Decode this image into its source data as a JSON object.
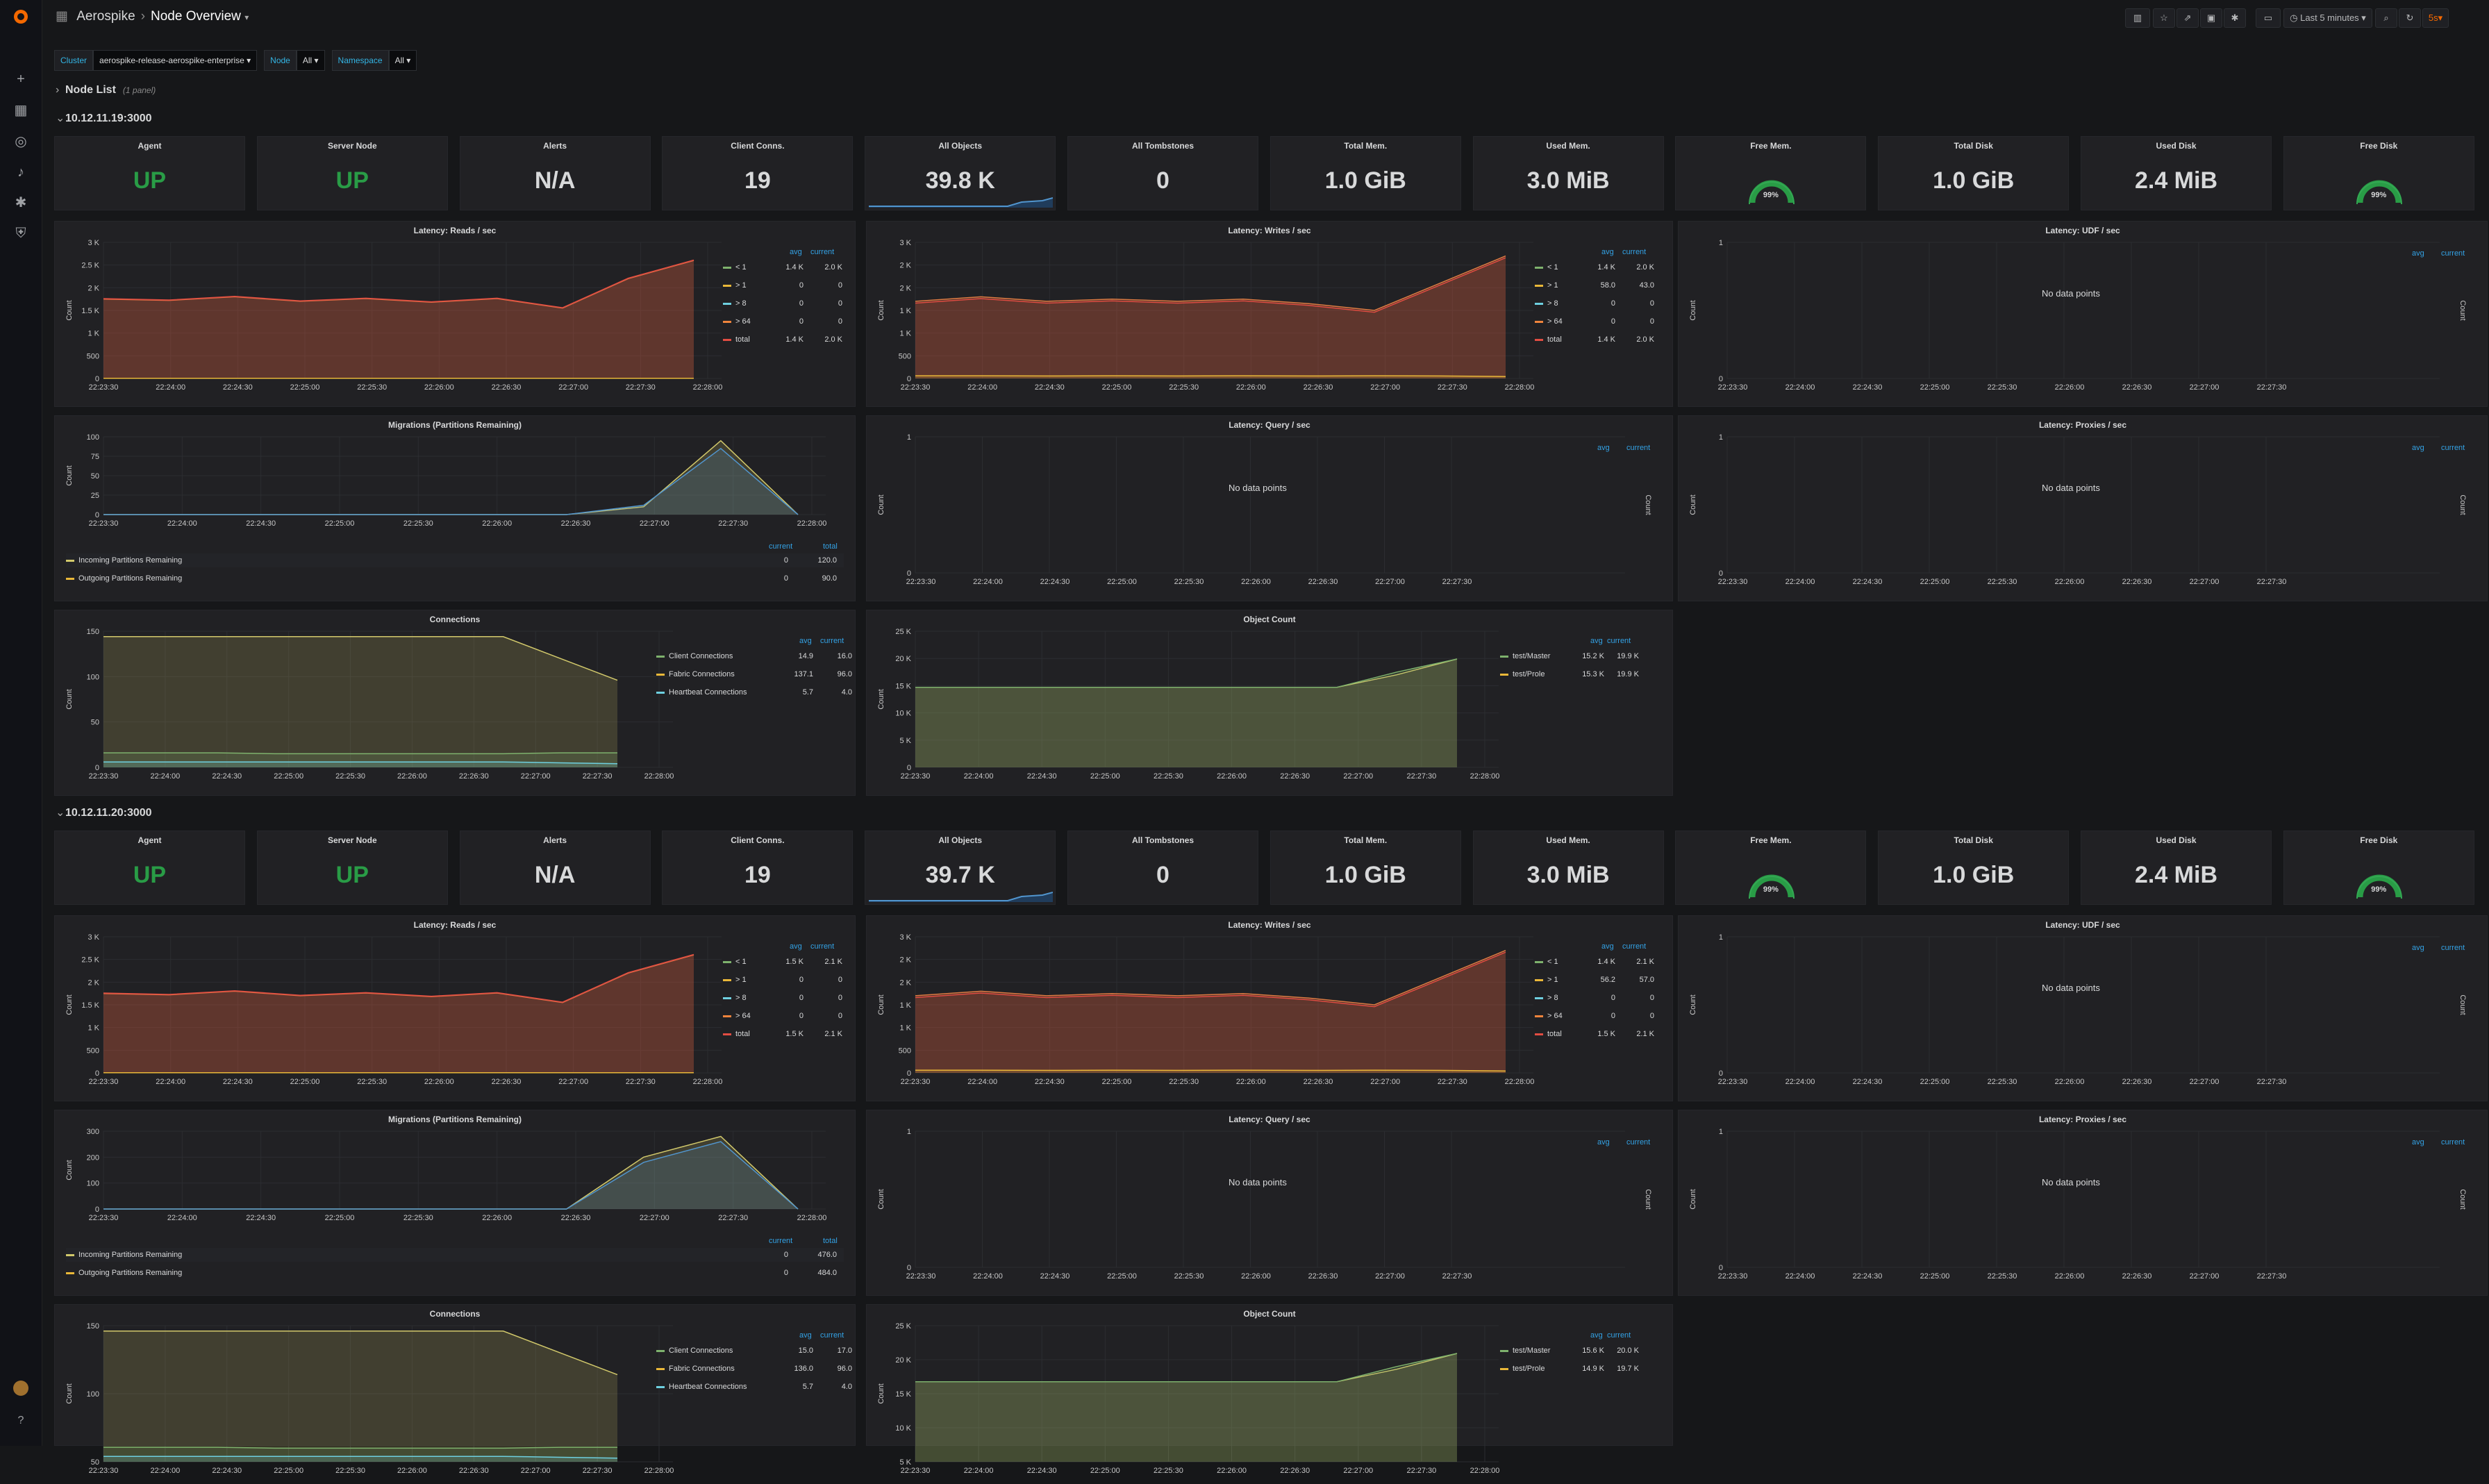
{
  "breadcrumb": {
    "folder": "Aerospike",
    "title": "Node Overview"
  },
  "toolbar": {
    "time_range": "Last 5 minutes",
    "refresh": "5s"
  },
  "variables": [
    {
      "label": "Cluster",
      "value": "aerospike-release-aerospike-enterprise"
    },
    {
      "label": "Node",
      "value": "All"
    },
    {
      "label": "Namespace",
      "value": "All"
    }
  ],
  "node_list": {
    "title": "Node List",
    "sub": "(1 panel)"
  },
  "colors": {
    "green": "#299c46",
    "yellow": "#d2c96b",
    "orange": "#e07b43",
    "blue": "#5195ce",
    "accent": "#33a2e5"
  },
  "common": {
    "times": [
      "22:23:30",
      "22:24:00",
      "22:24:30",
      "22:25:00",
      "22:25:30",
      "22:26:00",
      "22:26:30",
      "22:27:00",
      "22:27:30",
      "22:28:00"
    ],
    "count": "Count",
    "no_data": "No data points",
    "avg": "avg",
    "current": "current",
    "total": "total"
  },
  "sections": [
    {
      "title": "10.12.11.19:3000",
      "stats": {
        "agent": "UP",
        "server_node": "UP",
        "alerts": "N/A",
        "client_conns": "19",
        "all_objects": "39.8 K",
        "all_tombstones": "0",
        "total_mem": "1.0 GiB",
        "used_mem": "3.0 MiB",
        "free_mem": "99%",
        "total_disk": "1.0 GiB",
        "used_disk": "2.4 MiB",
        "free_disk": "99%"
      },
      "reads": {
        "title": "Latency: Reads / sec",
        "yticks": [
          "3 K",
          "2.5 K",
          "2 K",
          "1.5 K",
          "1 K",
          "500",
          "0"
        ],
        "legend": [
          [
            "< 1",
            "1.4 K",
            "2.0 K"
          ],
          [
            "> 1",
            "0",
            "0"
          ],
          [
            "> 8",
            "0",
            "0"
          ],
          [
            "> 64",
            "0",
            "0"
          ],
          [
            "total",
            "1.4 K",
            "2.0 K"
          ]
        ]
      },
      "writes": {
        "title": "Latency: Writes / sec",
        "yticks": [
          "3 K",
          "2 K",
          "2 K",
          "1 K",
          "1 K",
          "500",
          "0"
        ],
        "legend": [
          [
            "< 1",
            "1.4 K",
            "2.0 K"
          ],
          [
            "> 1",
            "58.0",
            "43.0"
          ],
          [
            "> 8",
            "0",
            "0"
          ],
          [
            "> 64",
            "0",
            "0"
          ],
          [
            "total",
            "1.4 K",
            "2.0 K"
          ]
        ]
      },
      "udf": {
        "title": "Latency: UDF / sec"
      },
      "migrations": {
        "title": "Migrations (Partitions Remaining)",
        "yticks": [
          "100",
          "75",
          "50",
          "25",
          "0"
        ],
        "legend": [
          [
            "Incoming Partitions Remaining",
            "0",
            "120.0"
          ],
          [
            "Outgoing Partitions Remaining",
            "0",
            "90.0"
          ]
        ]
      },
      "query": {
        "title": "Latency: Query / sec"
      },
      "proxies": {
        "title": "Latency: Proxies / sec"
      },
      "connections": {
        "title": "Connections",
        "yticks": [
          "150",
          "100",
          "50",
          "0"
        ],
        "legend": [
          [
            "Client Connections",
            "14.9",
            "16.0"
          ],
          [
            "Fabric Connections",
            "137.1",
            "96.0"
          ],
          [
            "Heartbeat Connections",
            "5.7",
            "4.0"
          ]
        ]
      },
      "objects": {
        "title": "Object Count",
        "yticks": [
          "25 K",
          "20 K",
          "15 K",
          "10 K",
          "5 K",
          "0"
        ],
        "legend": [
          [
            "test/Master",
            "15.2 K",
            "19.9 K"
          ],
          [
            "test/Prole",
            "15.3 K",
            "19.9 K"
          ]
        ]
      }
    },
    {
      "title": "10.12.11.20:3000",
      "stats": {
        "agent": "UP",
        "server_node": "UP",
        "alerts": "N/A",
        "client_conns": "19",
        "all_objects": "39.7 K",
        "all_tombstones": "0",
        "total_mem": "1.0 GiB",
        "used_mem": "3.0 MiB",
        "free_mem": "99%",
        "total_disk": "1.0 GiB",
        "used_disk": "2.4 MiB",
        "free_disk": "99%"
      },
      "reads": {
        "title": "Latency: Reads / sec",
        "yticks": [
          "3 K",
          "2.5 K",
          "2 K",
          "1.5 K",
          "1 K",
          "500",
          "0"
        ],
        "legend": [
          [
            "< 1",
            "1.5 K",
            "2.1 K"
          ],
          [
            "> 1",
            "0",
            "0"
          ],
          [
            "> 8",
            "0",
            "0"
          ],
          [
            "> 64",
            "0",
            "0"
          ],
          [
            "total",
            "1.5 K",
            "2.1 K"
          ]
        ]
      },
      "writes": {
        "title": "Latency: Writes / sec",
        "yticks": [
          "3 K",
          "2 K",
          "2 K",
          "1 K",
          "1 K",
          "500",
          "0"
        ],
        "legend": [
          [
            "< 1",
            "1.4 K",
            "2.1 K"
          ],
          [
            "> 1",
            "56.2",
            "57.0"
          ],
          [
            "> 8",
            "0",
            "0"
          ],
          [
            "> 64",
            "0",
            "0"
          ],
          [
            "total",
            "1.5 K",
            "2.1 K"
          ]
        ]
      },
      "udf": {
        "title": "Latency: UDF / sec"
      },
      "migrations": {
        "title": "Migrations (Partitions Remaining)",
        "yticks": [
          "300",
          "200",
          "100",
          "0"
        ],
        "legend": [
          [
            "Incoming Partitions Remaining",
            "0",
            "476.0"
          ],
          [
            "Outgoing Partitions Remaining",
            "0",
            "484.0"
          ]
        ]
      },
      "query": {
        "title": "Latency: Query / sec"
      },
      "proxies": {
        "title": "Latency: Proxies / sec"
      },
      "connections": {
        "title": "Connections",
        "yticks": [
          "150",
          "100",
          "50"
        ],
        "legend": [
          [
            "Client Connections",
            "15.0",
            "17.0"
          ],
          [
            "Fabric Connections",
            "136.0",
            "96.0"
          ],
          [
            "Heartbeat Connections",
            "5.7",
            "4.0"
          ]
        ]
      },
      "objects": {
        "title": "Object Count",
        "yticks": [
          "25 K",
          "20 K",
          "15 K",
          "10 K",
          "5 K"
        ],
        "legend": [
          [
            "test/Master",
            "15.6 K",
            "20.0 K"
          ],
          [
            "test/Prole",
            "14.9 K",
            "19.7 K"
          ]
        ]
      }
    }
  ],
  "stat_titles": [
    "Agent",
    "Server Node",
    "Alerts",
    "Client Conns.",
    "All Objects",
    "All Tombstones",
    "Total Mem.",
    "Used Mem.",
    "Free Mem.",
    "Total Disk",
    "Used Disk",
    "Free Disk"
  ],
  "chart_data": [
    {
      "type": "area",
      "title": "Latency: Reads / sec",
      "x": [
        "22:23:30",
        "22:24:00",
        "22:24:30",
        "22:25:00",
        "22:25:30",
        "22:26:00",
        "22:26:30",
        "22:27:00",
        "22:27:30",
        "22:28:00"
      ],
      "series": [
        {
          "name": "< 1",
          "values": [
            1750,
            1720,
            1800,
            1700,
            1760,
            1680,
            1760,
            1550,
            2200,
            2600
          ]
        },
        {
          "name": "total",
          "values": [
            1750,
            1720,
            1800,
            1700,
            1760,
            1680,
            1760,
            1550,
            2200,
            2600
          ]
        }
      ]
    },
    {
      "type": "area",
      "title": "Latency: Writes / sec",
      "x": [
        "22:23:30",
        "22:24:00",
        "22:24:30",
        "22:25:00",
        "22:25:30",
        "22:26:00",
        "22:26:30",
        "22:27:00",
        "22:27:30",
        "22:28:00"
      ],
      "series": [
        {
          "name": "< 1",
          "values": [
            1700,
            1800,
            1700,
            1750,
            1700,
            1750,
            1650,
            1500,
            2100,
            2700
          ]
        },
        {
          "name": "> 1",
          "values": [
            60,
            60,
            55,
            60,
            55,
            60,
            55,
            60,
            55,
            43
          ]
        }
      ]
    },
    {
      "type": "area",
      "title": "Migrations (Partitions Remaining)",
      "x": [
        "22:23:30",
        "22:24:00",
        "22:24:30",
        "22:25:00",
        "22:25:30",
        "22:26:00",
        "22:26:30",
        "22:27:00",
        "22:27:30",
        "22:28:00"
      ],
      "series": [
        {
          "name": "Incoming Partitions Remaining",
          "values": [
            0,
            0,
            0,
            0,
            0,
            0,
            0,
            10,
            95,
            0
          ]
        },
        {
          "name": "Outgoing Partitions Remaining",
          "values": [
            0,
            0,
            0,
            0,
            0,
            0,
            0,
            12,
            85,
            0
          ]
        }
      ]
    },
    {
      "type": "area",
      "title": "Connections",
      "series": [
        {
          "name": "Client Connections",
          "values": [
            16,
            16,
            16,
            15,
            15,
            15,
            15,
            15,
            16,
            16
          ]
        },
        {
          "name": "Fabric Connections",
          "values": [
            144,
            144,
            144,
            144,
            144,
            144,
            144,
            144,
            120,
            96
          ]
        },
        {
          "name": "Heartbeat Connections",
          "values": [
            6,
            6,
            6,
            6,
            6,
            6,
            6,
            6,
            5,
            4
          ]
        }
      ]
    },
    {
      "type": "area",
      "title": "Object Count",
      "series": [
        {
          "name": "test/Master",
          "values": [
            14700,
            14700,
            14700,
            14700,
            14700,
            14700,
            14700,
            14700,
            17000,
            19900
          ]
        },
        {
          "name": "test/Prole",
          "values": [
            14700,
            14700,
            14700,
            14700,
            14700,
            14700,
            14700,
            14700,
            17500,
            19900
          ]
        }
      ]
    }
  ]
}
